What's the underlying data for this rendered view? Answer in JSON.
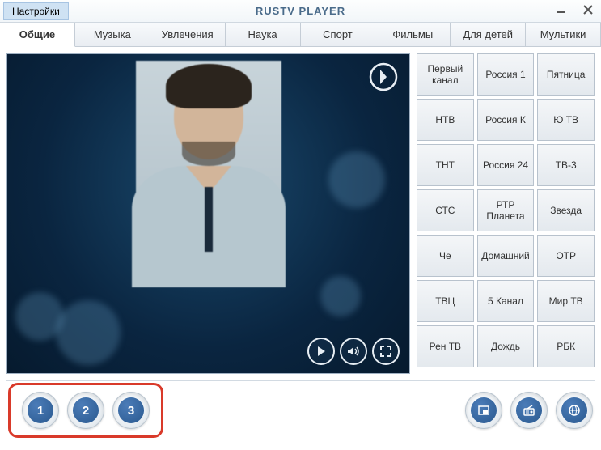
{
  "header": {
    "settings_label": "Настройки",
    "title": "RUSTV PLAYER"
  },
  "tabs": [
    {
      "label": "Общие",
      "active": true
    },
    {
      "label": "Музыка",
      "active": false
    },
    {
      "label": "Увлечения",
      "active": false
    },
    {
      "label": "Наука",
      "active": false
    },
    {
      "label": "Спорт",
      "active": false
    },
    {
      "label": "Фильмы",
      "active": false
    },
    {
      "label": "Для детей",
      "active": false
    },
    {
      "label": "Мультики",
      "active": false
    }
  ],
  "channels": [
    "Первый канал",
    "Россия 1",
    "Пятница",
    "НТВ",
    "Россия К",
    "Ю ТВ",
    "ТНТ",
    "Россия 24",
    "ТВ-3",
    "СТС",
    "РТР Планета",
    "Звезда",
    "Че",
    "Домашний",
    "ОТР",
    "ТВЦ",
    "5 Канал",
    "Мир ТВ",
    "Рен ТВ",
    "Дождь",
    "РБК"
  ],
  "presets": [
    "1",
    "2",
    "3"
  ],
  "icons": {
    "play": "play-icon",
    "volume": "volume-icon",
    "fullscreen": "fullscreen-icon",
    "pip": "pip-icon",
    "radio": "radio-icon",
    "globe": "globe-icon",
    "minimize": "minimize-icon",
    "close": "close-icon",
    "channel_logo": "channel-1-logo"
  }
}
